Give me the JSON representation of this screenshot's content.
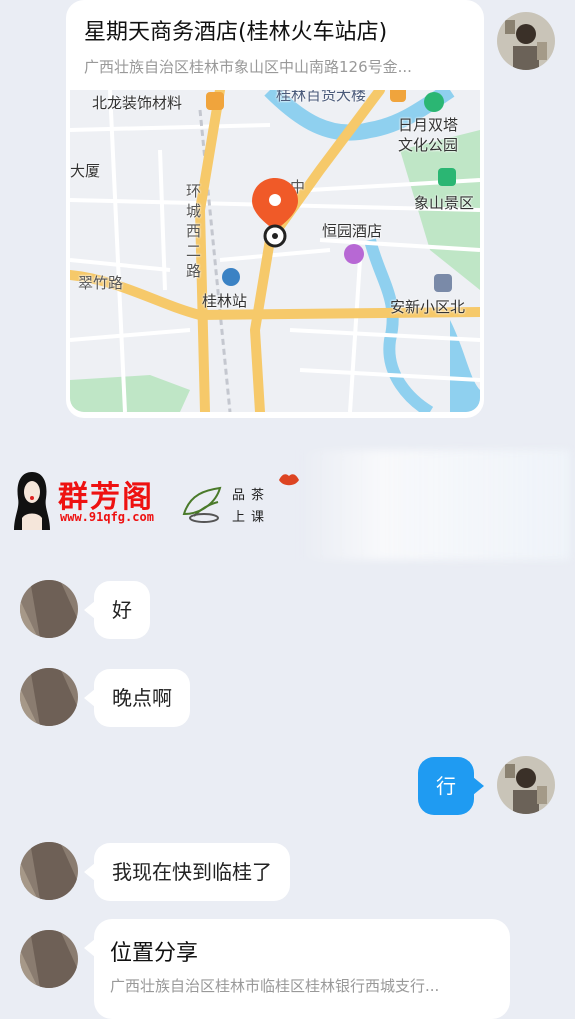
{
  "location_card": {
    "title": "星期天商务酒店(桂林火车站店)",
    "address": "广西壮族自治区桂林市象山区中山南路126号金...",
    "map_labels": {
      "beilong": "北龙装饰材料",
      "guilin_store": "桂林百货大楼",
      "riyue": "日月双塔",
      "culture_park": "文化公园",
      "dasha": "大厦",
      "xiangshan": "象山景区",
      "huancheng_1": "环",
      "huancheng_2": "城",
      "huancheng_3": "西",
      "huancheng_4": "二",
      "huancheng_5": "路",
      "zhong": "中",
      "hengyuan": "恒园酒店",
      "cuizhu": "翠竹路",
      "station": "桂林站",
      "anxin": "安新小区北"
    }
  },
  "banner": {
    "brand": "群芳阁",
    "url": "www.91qfg.com",
    "tag_line1": "品茶",
    "tag_line2": "上课"
  },
  "messages": [
    {
      "direction": "in",
      "text": "好"
    },
    {
      "direction": "in",
      "text": "晚点啊"
    },
    {
      "direction": "out",
      "text": "行"
    },
    {
      "direction": "in",
      "text": "我现在快到临桂了"
    }
  ],
  "share_card": {
    "title": "位置分享",
    "address": "广西壮族自治区桂林市临桂区桂林银行西城支行..."
  },
  "colors": {
    "background": "#eaedf4",
    "outgoing_bubble": "#1f9bf2",
    "pin": "#f05a28"
  }
}
